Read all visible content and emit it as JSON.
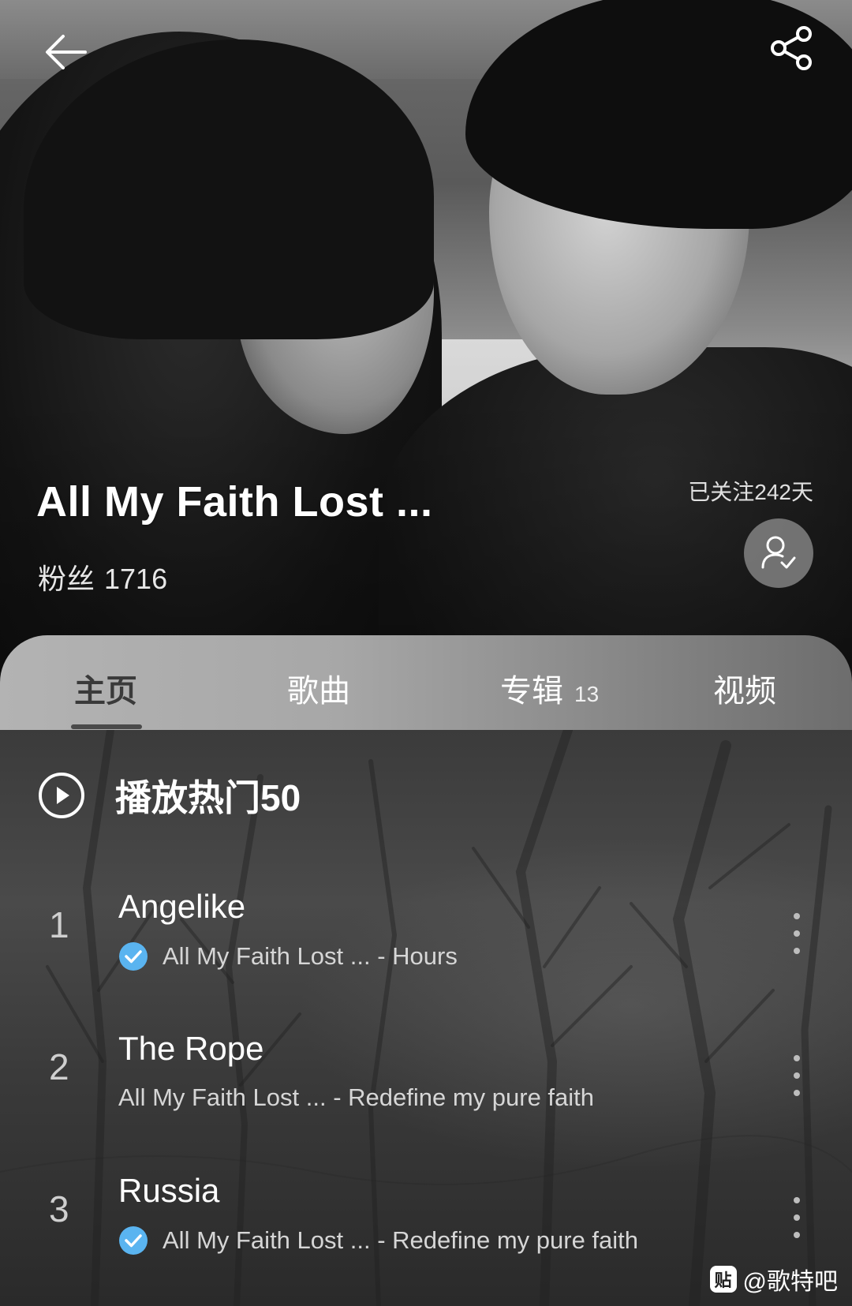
{
  "header": {
    "back_icon": "arrow-left-icon",
    "share_icon": "share-icon"
  },
  "artist": {
    "name": "All My Faith Lost ...",
    "fans_label": "粉丝",
    "fans_count": "1716",
    "follow_days": "已关注242天",
    "follow_icon": "user-check-icon"
  },
  "tabs": [
    {
      "label": "主页",
      "active": true
    },
    {
      "label": "歌曲",
      "active": false
    },
    {
      "label": "专辑",
      "count": "13",
      "active": false
    },
    {
      "label": "视频",
      "active": false
    }
  ],
  "play_hot": {
    "label": "播放热门50",
    "icon": "play-circle-icon"
  },
  "tracks": [
    {
      "rank": "1",
      "title": "Angelike",
      "verified": true,
      "subtitle": "All My Faith Lost ... - Hours"
    },
    {
      "rank": "2",
      "title": "The Rope",
      "verified": false,
      "subtitle": "All My Faith Lost ... - Redefine my pure faith"
    },
    {
      "rank": "3",
      "title": "Russia",
      "verified": true,
      "subtitle": "All My Faith Lost ... - Redefine my pure faith"
    }
  ],
  "watermark": {
    "logo_text": "贴",
    "text": "@歌特吧"
  },
  "colors": {
    "verified_badge": "#5ab4f0",
    "tab_active": "#3a3a3a"
  }
}
